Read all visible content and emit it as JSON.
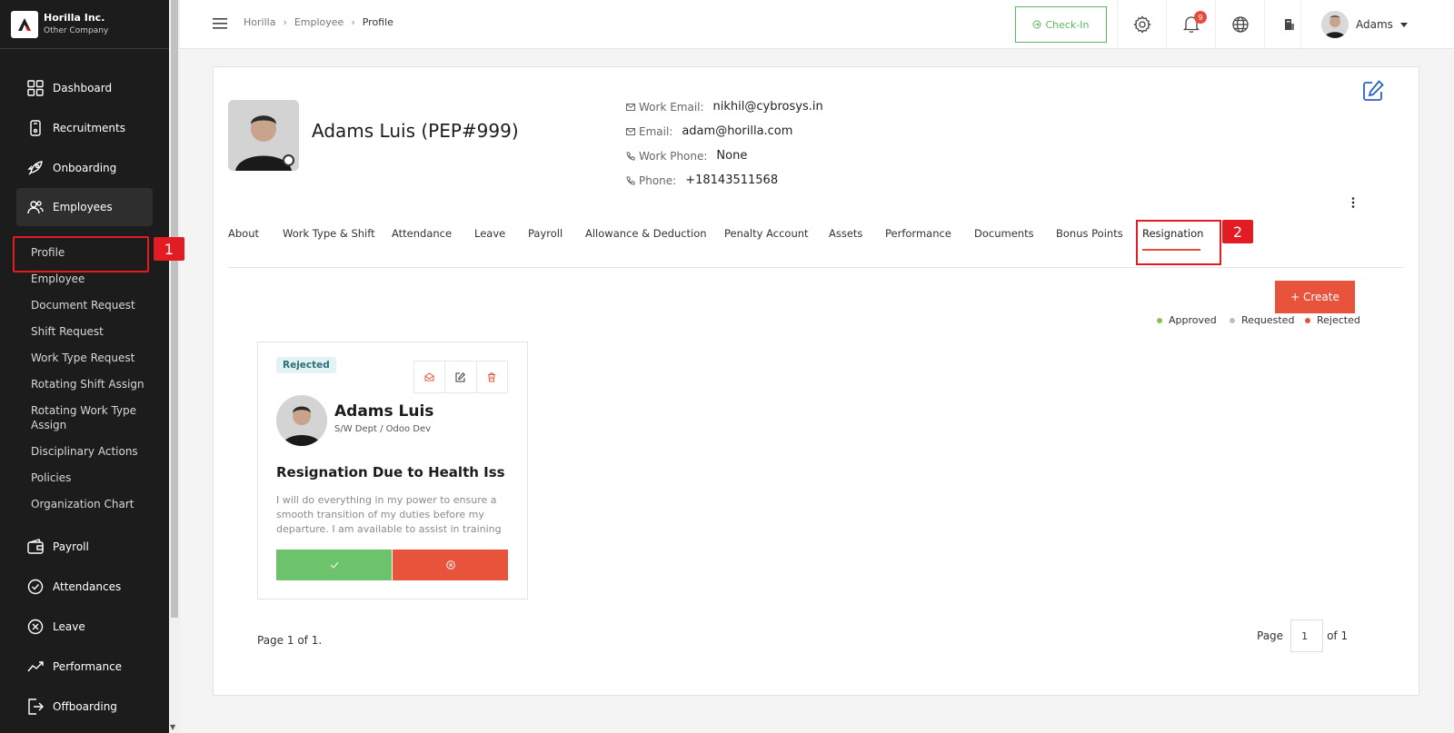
{
  "company": {
    "name": "Horilla Inc.",
    "sub": "Other Company"
  },
  "sidebar": {
    "items": [
      {
        "label": "Dashboard",
        "icon": "dashboard-icon"
      },
      {
        "label": "Recruitments",
        "icon": "recruitment-icon"
      },
      {
        "label": "Onboarding",
        "icon": "rocket-icon"
      },
      {
        "label": "Employees",
        "icon": "people-icon"
      },
      {
        "label": "Payroll",
        "icon": "wallet-icon"
      },
      {
        "label": "Attendances",
        "icon": "check-circle-icon"
      },
      {
        "label": "Leave",
        "icon": "x-circle-icon"
      },
      {
        "label": "Performance",
        "icon": "trend-icon"
      },
      {
        "label": "Offboarding",
        "icon": "exit-icon"
      }
    ],
    "sub_items": [
      "Profile",
      "Employee",
      "Document Request",
      "Shift Request",
      "Work Type Request",
      "Rotating Shift Assign",
      "Rotating Work Type Assign",
      "Disciplinary Actions",
      "Policies",
      "Organization Chart"
    ]
  },
  "annotations": {
    "first": "1",
    "second": "2"
  },
  "breadcrumb": [
    "Horilla",
    "Employee",
    "Profile"
  ],
  "topbar": {
    "checkin": "Check-In",
    "notifications": "9",
    "user": "Adams"
  },
  "profile": {
    "name": "Adams Luis (PEP#999)",
    "work_email_label": "Work Email:",
    "work_email": "nikhil@cybrosys.in",
    "email_label": "Email:",
    "email": "adam@horilla.com",
    "work_phone_label": "Work Phone:",
    "work_phone": "None",
    "phone_label": "Phone:",
    "phone": "+18143511568"
  },
  "tabs": [
    "About",
    "Work Type & Shift",
    "Attendance",
    "Leave",
    "Payroll",
    "Allowance & Deduction",
    "Penalty Account",
    "Assets",
    "Performance",
    "Documents",
    "Bonus Points",
    "Resignation"
  ],
  "create_label": "+ Create",
  "legend": [
    {
      "label": "Approved",
      "color": "#8bc34a"
    },
    {
      "label": "Requested",
      "color": "#bdbdbd"
    },
    {
      "label": "Rejected",
      "color": "#e8533c"
    }
  ],
  "card": {
    "status": "Rejected",
    "name": "Adams Luis",
    "dept": "S/W Dept / Odoo Dev",
    "title": "Resignation Due to Health Iss",
    "description": "I will do everything in my power to ensure a smooth transition of my duties before my departure. I am available to assist in training your replacement and providing"
  },
  "pagination": {
    "summary": "Page 1 of 1.",
    "page_label": "Page",
    "current": "1",
    "of_label": "of 1"
  }
}
